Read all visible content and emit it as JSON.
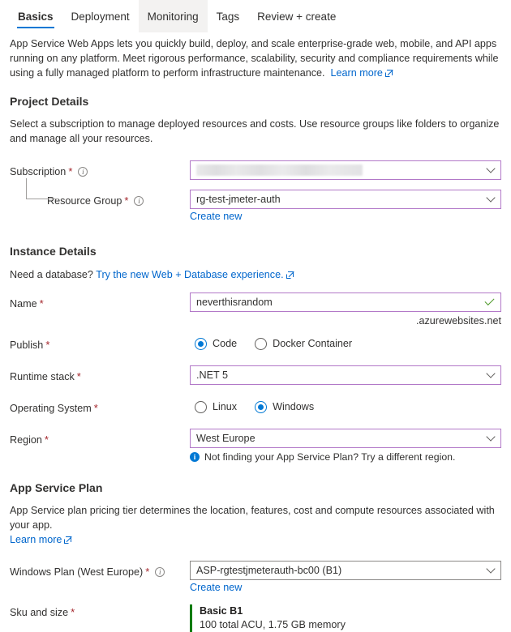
{
  "tabs": [
    {
      "label": "Basics",
      "state": "active"
    },
    {
      "label": "Deployment",
      "state": "normal"
    },
    {
      "label": "Monitoring",
      "state": "hover"
    },
    {
      "label": "Tags",
      "state": "normal"
    },
    {
      "label": "Review + create",
      "state": "normal"
    }
  ],
  "intro": {
    "text": "App Service Web Apps lets you quickly build, deploy, and scale enterprise-grade web, mobile, and API apps running on any platform. Meet rigorous performance, scalability, security and compliance requirements while using a fully managed platform to perform infrastructure maintenance.",
    "learn_more": "Learn more"
  },
  "project_details": {
    "heading": "Project Details",
    "description": "Select a subscription to manage deployed resources and costs. Use resource groups like folders to organize and manage all your resources.",
    "subscription": {
      "label": "Subscription",
      "value": "",
      "redacted": true,
      "info_icon": "info-icon"
    },
    "resource_group": {
      "label": "Resource Group",
      "value": "rg-test-jmeter-auth",
      "create_new": "Create new",
      "info_icon": "info-icon"
    }
  },
  "instance_details": {
    "heading": "Instance Details",
    "database_prompt": "Need a database?",
    "database_link": "Try the new Web + Database experience.",
    "name": {
      "label": "Name",
      "value": "neverthisrandom",
      "suffix": ".azurewebsites.net",
      "valid": true
    },
    "publish": {
      "label": "Publish",
      "options": [
        {
          "label": "Code",
          "selected": true
        },
        {
          "label": "Docker Container",
          "selected": false
        }
      ]
    },
    "runtime_stack": {
      "label": "Runtime stack",
      "value": ".NET 5"
    },
    "operating_system": {
      "label": "Operating System",
      "options": [
        {
          "label": "Linux",
          "selected": false
        },
        {
          "label": "Windows",
          "selected": true
        }
      ]
    },
    "region": {
      "label": "Region",
      "value": "West Europe",
      "note": "Not finding your App Service Plan? Try a different region."
    }
  },
  "app_service_plan": {
    "heading": "App Service Plan",
    "description": "App Service plan pricing tier determines the location, features, cost and compute resources associated with your app.",
    "learn_more": "Learn more",
    "windows_plan": {
      "label": "Windows Plan (West Europe)",
      "value": "ASP-rgtestjmeterauth-bc00 (B1)",
      "create_new": "Create new",
      "info_icon": "info-icon"
    },
    "sku": {
      "label": "Sku and size",
      "title": "Basic B1",
      "detail": "100 total ACU, 1.75 GB memory"
    }
  },
  "colors": {
    "accent": "#0078d4",
    "link": "#0066cc",
    "required": "#a4262c",
    "focus_border": "#b278c8",
    "sku_bar": "#107c10",
    "valid_check": "#4f9a2b"
  }
}
